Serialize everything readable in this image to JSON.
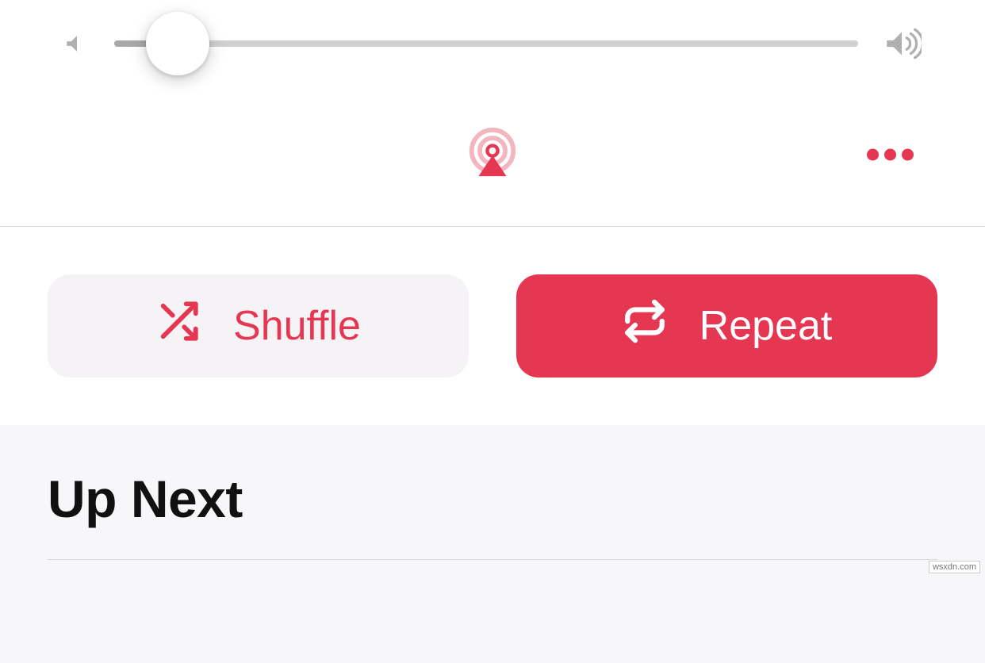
{
  "volume": {
    "percent": 8.5
  },
  "actions": {
    "shuffle_label": "Shuffle",
    "repeat_label": "Repeat"
  },
  "queue": {
    "heading": "Up Next"
  },
  "colors": {
    "accent": "#e63752",
    "shuffle_bg": "#f6f3f7",
    "track_bg": "#d0d0d0",
    "track_fill": "#a8a8a8"
  },
  "watermark": "wsxdn.com"
}
